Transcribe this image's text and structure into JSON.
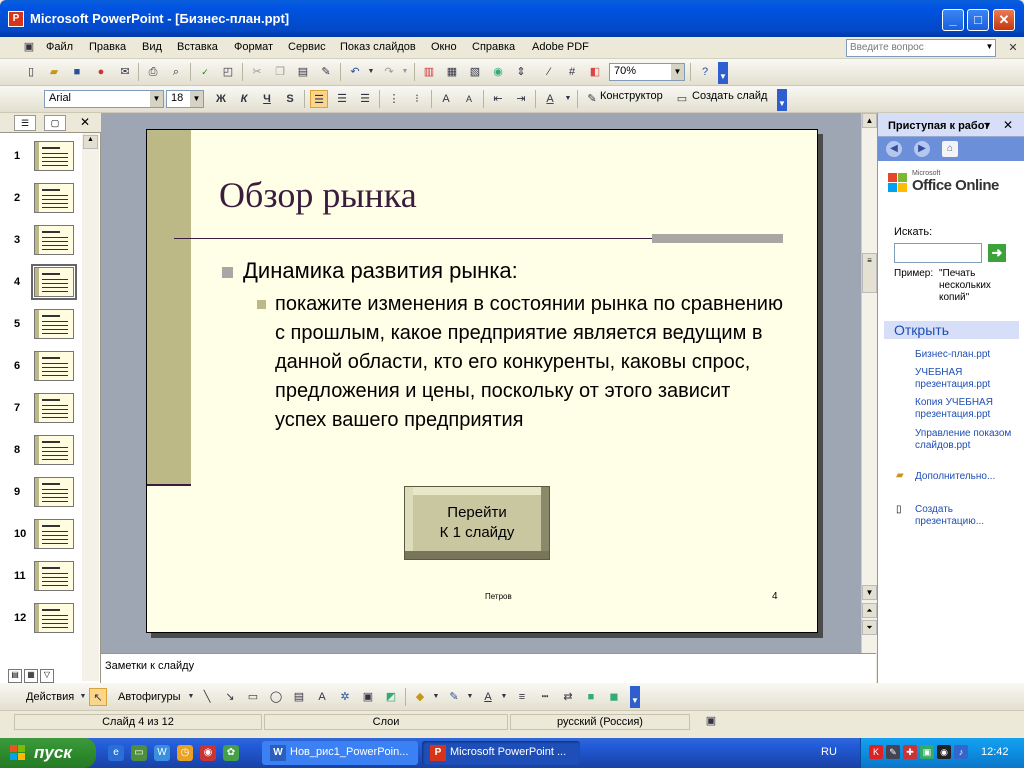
{
  "window": {
    "title": "Microsoft PowerPoint - [Бизнес-план.ppt]",
    "minimize": "_",
    "maximize": "□",
    "close": "✕"
  },
  "menu": {
    "items": [
      "Файл",
      "Правка",
      "Вид",
      "Вставка",
      "Формат",
      "Сервис",
      "Показ слайдов",
      "Окно",
      "Справка",
      "Adobe PDF"
    ],
    "help_placeholder": "Введите вопрос"
  },
  "toolbar_standard": {
    "zoom": "70%"
  },
  "toolbar_format": {
    "font": "Arial",
    "size": "18",
    "bold": "Ж",
    "italic": "К",
    "underline": "Ч",
    "shadow": "S",
    "designer": "Конструктор",
    "new_slide": "Создать слайд"
  },
  "thumbnails": {
    "numbers": [
      "1",
      "2",
      "3",
      "4",
      "5",
      "6",
      "7",
      "8",
      "9",
      "10",
      "11",
      "12"
    ],
    "selected": "4"
  },
  "slide": {
    "title": "Обзор рынка",
    "bullet1": "Динамика развития рынка:",
    "bullet2": "покажите изменения в состоянии рынка по сравнению с прошлым, какое предприятие является ведущим в данной области, кто его конкуренты, каковы спрос, предложения и цены, поскольку от этого зависит успех вашего предприятия",
    "button_line1": "Перейти",
    "button_line2": "К 1 слайду",
    "footer": "Петров",
    "number": "4"
  },
  "notes": {
    "placeholder": "Заметки к слайду"
  },
  "taskpane": {
    "title": "Приступая к работе",
    "office_small": "Microsoft",
    "office_brand": "Office Online",
    "search_label": "Искать:",
    "example_label": "Пример:",
    "example_value": "\"Печать нескольких копий\"",
    "open_header": "Открыть",
    "files": [
      "Бизнес-план.ppt",
      "УЧЕБНАЯ презентация.ppt",
      "Копия УЧЕБНАЯ презентация.ppt",
      "Управление показом слайдов.ppt"
    ],
    "more": "Дополнительно...",
    "create": "Создать презентацию..."
  },
  "drawing_toolbar": {
    "actions": "Действия",
    "autoshapes": "Автофигуры"
  },
  "status": {
    "slide": "Слайд 4 из 12",
    "layers": "Слои",
    "language": "русский (Россия)"
  },
  "taskbar": {
    "start": "пуск",
    "task1": "Нов_рис1_PowerPoin...",
    "task2": "Microsoft PowerPoint ...",
    "lang": "RU",
    "clock": "12:42"
  },
  "colors": {
    "slide_bg": "#fffee6",
    "slide_accent": "#bcb987",
    "title_color": "#3a1d3d",
    "xp_blue": "#0054e3"
  }
}
